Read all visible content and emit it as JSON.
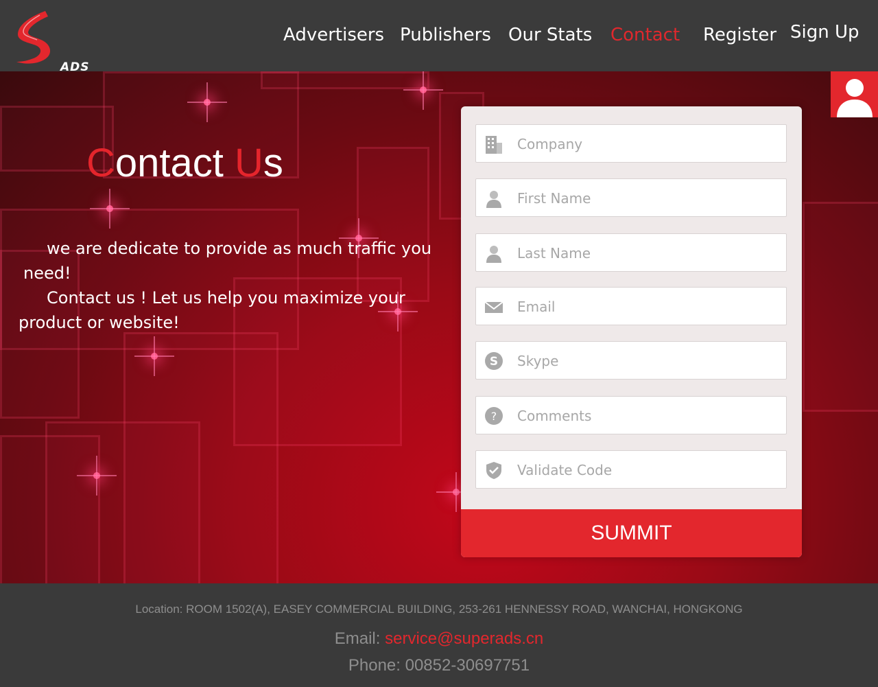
{
  "brand": {
    "logo_text": "ADS",
    "accent": "#e3272d"
  },
  "nav": {
    "items": [
      {
        "label": "Advertisers",
        "active": false
      },
      {
        "label": "Publishers",
        "active": false
      },
      {
        "label": "Our Stats",
        "active": false
      },
      {
        "label": "Contact",
        "active": true
      },
      {
        "label": "Register",
        "active": false
      },
      {
        "label": "Sign Up",
        "active": false
      }
    ]
  },
  "hero": {
    "title_first_letter": "C",
    "title_middle": "ontact ",
    "title_u": "U",
    "title_end": "s",
    "intro_line1": "we are dedicate to provide as much traffic you",
    "intro_line2": "need!",
    "intro_line3": "Contact us ! Let us help you maximize your",
    "intro_line4": "product or website!"
  },
  "form": {
    "fields": [
      {
        "placeholder": "Company",
        "icon": "building-icon",
        "value": ""
      },
      {
        "placeholder": "First Name",
        "icon": "user-icon",
        "value": ""
      },
      {
        "placeholder": "Last Name",
        "icon": "user-icon",
        "value": ""
      },
      {
        "placeholder": "Email",
        "icon": "envelope-icon",
        "value": ""
      },
      {
        "placeholder": "Skype",
        "icon": "skype-icon",
        "value": ""
      },
      {
        "placeholder": "Comments",
        "icon": "question-icon",
        "value": ""
      },
      {
        "placeholder": "Validate Code",
        "icon": "shield-check-icon",
        "value": ""
      }
    ],
    "submit_label": "SUMMIT"
  },
  "footer": {
    "location": "Location: ROOM 1502(A), EASEY COMMERCIAL BUILDING, 253-261 HENNESSY ROAD, WANCHAI, HONGKONG",
    "email_label": "Email: ",
    "email_value": "service@superads.cn",
    "phone": "Phone: 00852-30697751"
  }
}
